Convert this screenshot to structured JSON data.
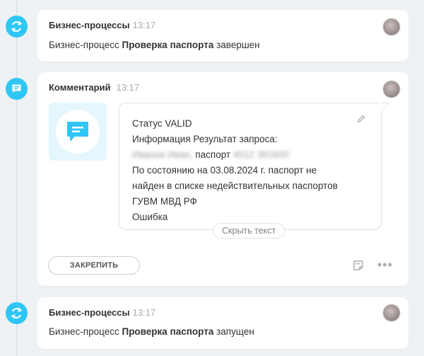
{
  "events": [
    {
      "title": "Бизнес-процессы",
      "time": "13:17",
      "text_prefix": "Бизнес-процесс",
      "text_bold": "Проверка паспорта",
      "text_suffix": "завершен"
    },
    {
      "title": "Комментарий",
      "time": "13:17",
      "lines": {
        "status": "Статус VALID",
        "info": "Информация Результат запроса:",
        "blur_name": "Иванов Иван,",
        "passport_label": "паспорт",
        "blur_number": "4512 381600",
        "state_line1": "По состоянию на 03.08.2024 г. паспорт не",
        "state_line2": "найден в списке недействительных паспортов",
        "state_line3": "ГУВМ МВД РФ",
        "error": "Ошибка"
      },
      "hide_text_label": "Скрыть текст",
      "pin_label": "ЗАКРЕПИТЬ"
    },
    {
      "title": "Бизнес-процессы",
      "time": "13:17",
      "text_prefix": "Бизнес-процесс",
      "text_bold": "Проверка паспорта",
      "text_suffix": "запущен"
    }
  ],
  "icons": {
    "bp": "refresh-cycle-icon",
    "comment": "chat-bubble-icon",
    "edit": "pencil-icon",
    "note": "note-icon",
    "more": "more-dots-icon"
  },
  "colors": {
    "accent": "#2fc6f6",
    "background": "#eef2f4"
  }
}
